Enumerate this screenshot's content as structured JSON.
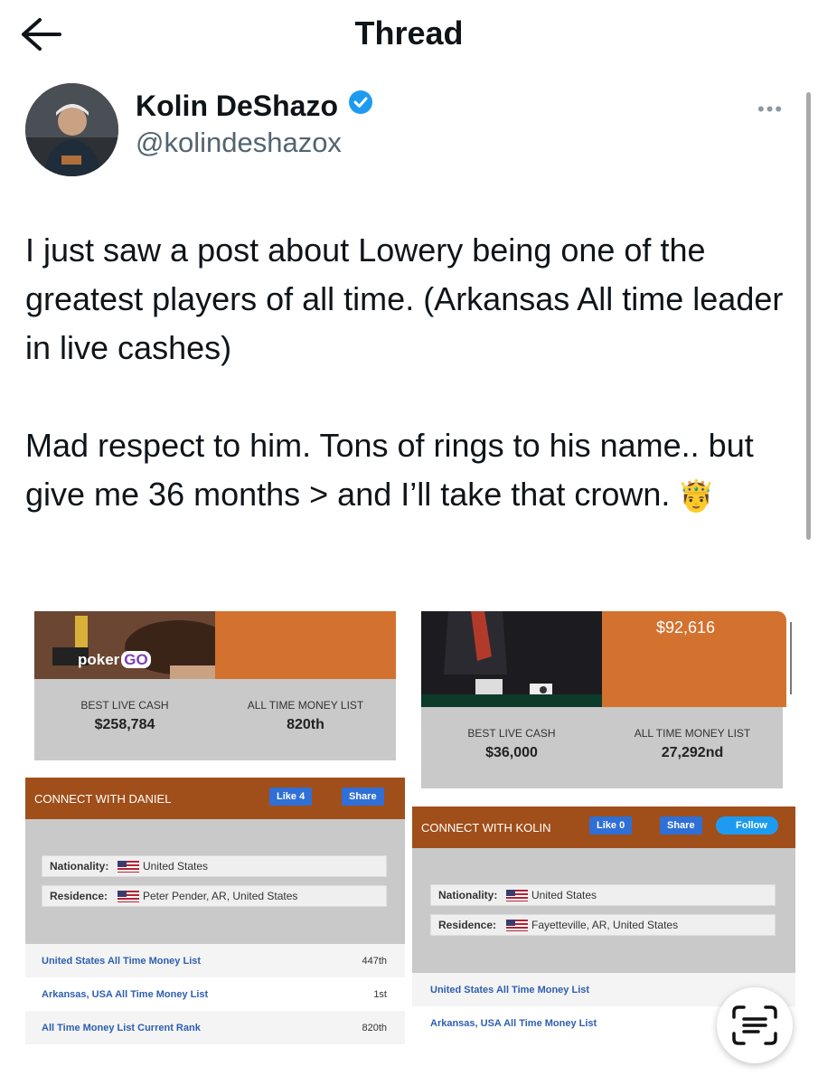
{
  "header": {
    "title": "Thread"
  },
  "author": {
    "name": "Kolin DeShazo",
    "handle": "@kolindeshazox",
    "verified": true
  },
  "tweet": {
    "paragraph1": "I just saw a post about Lowery being one of the greatest players of all time. (Arkansas All time leader in live cashes)",
    "paragraph2": "Mad respect to him. Tons of rings to his name.. but give me 36 months > and I’ll take that crown.",
    "emoji": "🤴"
  },
  "left_card": {
    "logo": "poker",
    "logo_badge": "GO",
    "best_live_cash_label": "BEST LIVE CASH",
    "best_live_cash": "$258,784",
    "money_list_label": "ALL TIME MONEY LIST",
    "money_list": "820th",
    "connect_label": "CONNECT WITH DANIEL",
    "like_label": "Like 4",
    "share_label": "Share",
    "nationality_label": "Nationality:",
    "nationality": "United States",
    "residence_label": "Residence:",
    "residence": "Peter Pender, AR, United States",
    "rows": [
      {
        "label": "United States All Time Money List",
        "rank": "447th"
      },
      {
        "label": "Arkansas, USA All Time Money List",
        "rank": "1st"
      },
      {
        "label": "All Time Money List Current Rank",
        "rank": "820th"
      }
    ]
  },
  "right_card": {
    "top_amount": "$92,616",
    "best_live_cash_label": "BEST LIVE CASH",
    "best_live_cash": "$36,000",
    "money_list_label": "ALL TIME MONEY LIST",
    "money_list": "27,292nd",
    "connect_label": "CONNECT WITH KOLIN",
    "like_label": "Like 0",
    "share_label": "Share",
    "follow_label": "Follow",
    "nationality_label": "Nationality:",
    "nationality": "United States",
    "residence_label": "Residence:",
    "residence": "Fayetteville, AR, United States",
    "rows": [
      {
        "label": "United States All Time Money List",
        "rank": ""
      },
      {
        "label": "Arkansas, USA All Time Money List",
        "rank": ""
      }
    ]
  },
  "colors": {
    "orange": "#d3712f",
    "connect_bar": "#a04f1a",
    "link": "#2d5fb0",
    "verified": "#1d9bf0"
  }
}
